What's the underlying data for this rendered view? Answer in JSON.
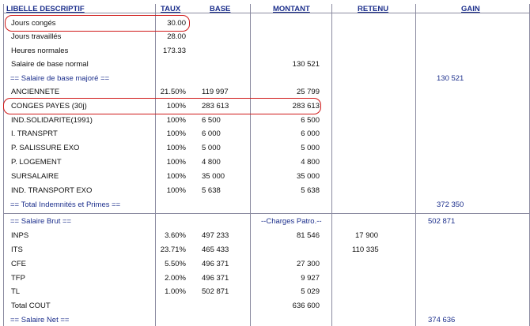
{
  "headers": {
    "libelle": "LIBELLE DESCRIPTIF",
    "taux": "TAUX",
    "base": "BASE",
    "montant": "MONTANT",
    "retenu": "RETENU",
    "gain": "GAIN"
  },
  "rows": [
    {
      "label": "Jours congés",
      "taux": "30.00",
      "base": "",
      "montant": "",
      "retenu": "",
      "gain": ""
    },
    {
      "label": "Jours travaillés",
      "taux": "28.00",
      "base": "",
      "montant": "",
      "retenu": "",
      "gain": ""
    },
    {
      "label": "Heures normales",
      "taux": "173.33",
      "base": "",
      "montant": "",
      "retenu": "",
      "gain": ""
    },
    {
      "label": "Salaire de base normal",
      "taux": "",
      "base": "",
      "montant": "130 521",
      "retenu": "",
      "gain": ""
    },
    {
      "label": "== Salaire de base majoré ==",
      "taux": "",
      "base": "",
      "montant": "",
      "retenu": "",
      "gain": "130 521"
    },
    {
      "label": "ANCIENNETE",
      "taux": "21.50%",
      "base": "119 997",
      "montant": "25 799",
      "retenu": "",
      "gain": ""
    },
    {
      "label": "CONGES PAYES (30j)",
      "taux": "100%",
      "base": "283 613",
      "montant": "283 613",
      "retenu": "",
      "gain": ""
    },
    {
      "label": "IND.SOLIDARITE(1991)",
      "taux": "100%",
      "base": "6 500",
      "montant": "6 500",
      "retenu": "",
      "gain": ""
    },
    {
      "label": "I. TRANSPRT",
      "taux": "100%",
      "base": "6 000",
      "montant": "6 000",
      "retenu": "",
      "gain": ""
    },
    {
      "label": "P. SALISSURE EXO",
      "taux": "100%",
      "base": "5 000",
      "montant": "5 000",
      "retenu": "",
      "gain": ""
    },
    {
      "label": "P. LOGEMENT",
      "taux": "100%",
      "base": "4 800",
      "montant": "4 800",
      "retenu": "",
      "gain": ""
    },
    {
      "label": "SURSALAIRE",
      "taux": "100%",
      "base": "35 000",
      "montant": "35 000",
      "retenu": "",
      "gain": ""
    },
    {
      "label": "IND. TRANSPORT EXO",
      "taux": "100%",
      "base": "5 638",
      "montant": "5 638",
      "retenu": "",
      "gain": ""
    },
    {
      "label": "== Total Indemnités et Primes ==",
      "taux": "",
      "base": "",
      "montant": "",
      "retenu": "",
      "gain": "372 350"
    }
  ],
  "rows2": [
    {
      "label": "== Salaire Brut ==",
      "taux": "",
      "base": "",
      "montant": "--Charges Patro.--",
      "retenu": "",
      "gain": "502 871"
    },
    {
      "label": "INPS",
      "taux": "3.60%",
      "base": "497 233",
      "montant": "81 546",
      "retenu": "17 900",
      "gain": ""
    },
    {
      "label": "ITS",
      "taux": "23.71%",
      "base": "465 433",
      "montant": "",
      "retenu": "110 335",
      "gain": ""
    },
    {
      "label": "CFE",
      "taux": "5.50%",
      "base": "496 371",
      "montant": "27 300",
      "retenu": "",
      "gain": ""
    },
    {
      "label": "TFP",
      "taux": "2.00%",
      "base": "496 371",
      "montant": "9 927",
      "retenu": "",
      "gain": ""
    },
    {
      "label": "TL",
      "taux": "1.00%",
      "base": "502 871",
      "montant": "5 029",
      "retenu": "",
      "gain": ""
    },
    {
      "label": "Total COUT",
      "taux": "",
      "base": "",
      "montant": "636 600",
      "retenu": "",
      "gain": ""
    },
    {
      "label": "== Salaire Net ==",
      "taux": "",
      "base": "",
      "montant": "",
      "retenu": "",
      "gain": "374 636"
    }
  ],
  "colors": {
    "header": "#1c2f8c",
    "highlight": "#d01818",
    "grid": "#8a8aa0"
  }
}
